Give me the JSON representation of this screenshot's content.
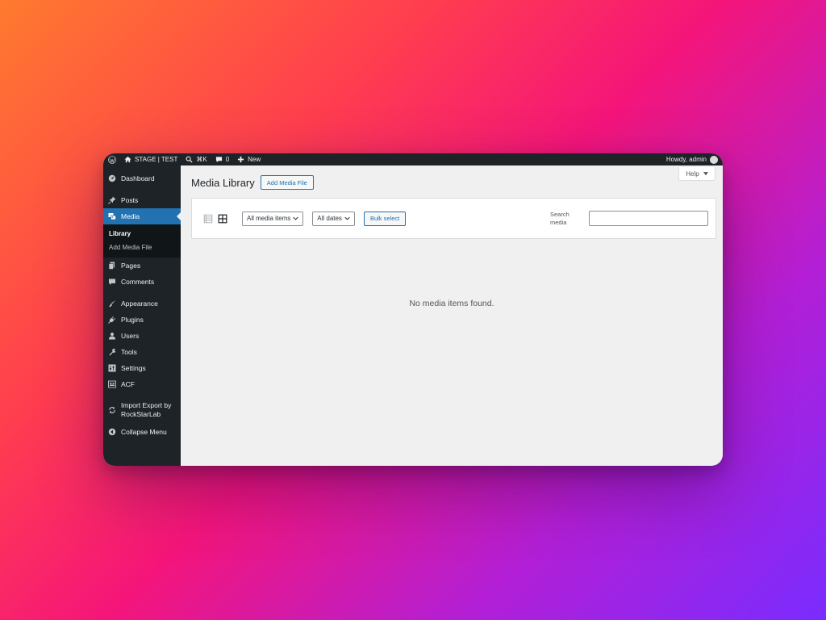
{
  "adminbar": {
    "site_name": "STAGE | TEST",
    "shortcut": "⌘K",
    "comments_count": "0",
    "new_label": "New",
    "howdy": "Howdy, admin"
  },
  "sidebar": {
    "items": [
      {
        "label": "Dashboard",
        "icon": "dashboard-icon"
      },
      {
        "label": "Posts",
        "icon": "pushpin-icon"
      },
      {
        "label": "Media",
        "icon": "media-icon",
        "current": true
      },
      {
        "label": "Pages",
        "icon": "pages-icon"
      },
      {
        "label": "Comments",
        "icon": "comment-icon"
      },
      {
        "label": "Appearance",
        "icon": "brush-icon"
      },
      {
        "label": "Plugins",
        "icon": "plug-icon"
      },
      {
        "label": "Users",
        "icon": "user-icon"
      },
      {
        "label": "Tools",
        "icon": "wrench-icon"
      },
      {
        "label": "Settings",
        "icon": "settings-icon"
      },
      {
        "label": "ACF",
        "icon": "acf-icon"
      },
      {
        "label": "Import Export by RockStarLab",
        "icon": "sync-icon"
      },
      {
        "label": "Collapse Menu",
        "icon": "collapse-icon"
      }
    ],
    "submenu": [
      {
        "label": "Library",
        "active": true
      },
      {
        "label": "Add Media File"
      }
    ]
  },
  "main": {
    "help_label": "Help",
    "title": "Media Library",
    "add_button": "Add Media File",
    "filter_media": "All media items",
    "filter_dates": "All dates",
    "bulk_select": "Bulk select",
    "search_label": "Search media",
    "search_value": "",
    "empty_message": "No media items found."
  },
  "colors": {
    "admin_dark": "#1d2327",
    "accent_blue": "#2271b1",
    "content_bg": "#f0f0f1"
  }
}
